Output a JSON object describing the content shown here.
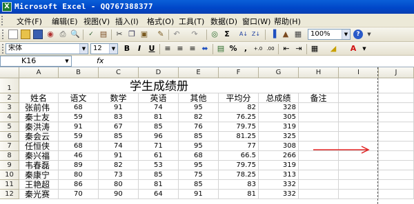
{
  "app": {
    "title": "Microsoft Excel - QQ767388377",
    "icon_label": "X"
  },
  "menu": [
    {
      "label": "文件(F)"
    },
    {
      "label": "编辑(E)"
    },
    {
      "label": "视图(V)"
    },
    {
      "label": "插入(I)"
    },
    {
      "label": "格式(O)"
    },
    {
      "label": "工具(T)"
    },
    {
      "label": "数据(D)"
    },
    {
      "label": "窗口(W)"
    },
    {
      "label": "帮助(H)"
    }
  ],
  "toolbar_standard": {
    "icons": [
      "new-icon",
      "open-icon",
      "save-icon",
      "permission-icon",
      "print-icon",
      "print-preview-icon",
      "spelling-icon",
      "research-icon",
      "cut-icon",
      "copy-icon",
      "paste-icon",
      "format-painter-icon",
      "undo-icon",
      "redo-icon",
      "hyperlink-icon",
      "autosum-icon",
      "sort-ascending-icon",
      "sort-descending-icon",
      "chart-wizard-icon",
      "drawing-icon",
      "help-icon"
    ],
    "zoom": "100%"
  },
  "toolbar_format": {
    "font_name": "宋体",
    "font_size": "12",
    "bold": "B",
    "italic": "I",
    "underline": "U",
    "percent": "%",
    "comma": ","
  },
  "formula_bar": {
    "name_box": "K16",
    "fx": "fx",
    "content": ""
  },
  "columns": [
    "A",
    "B",
    "C",
    "D",
    "E",
    "F",
    "G",
    "H",
    "I",
    "J"
  ],
  "rows": [
    "1",
    "2",
    "3",
    "4",
    "5",
    "6",
    "7",
    "8",
    "9",
    "10",
    "11",
    "12"
  ],
  "sheet": {
    "title": "学生成绩册",
    "headers": [
      "姓名",
      "语文",
      "数学",
      "英语",
      "其他",
      "平均分",
      "总成绩",
      "备注"
    ],
    "data": [
      [
        "张前伟",
        "68",
        "91",
        "74",
        "95",
        "82",
        "328"
      ],
      [
        "秦士友",
        "59",
        "83",
        "81",
        "82",
        "76.25",
        "305"
      ],
      [
        "秦洪涛",
        "91",
        "67",
        "85",
        "76",
        "79.75",
        "319"
      ],
      [
        "秦会云",
        "59",
        "85",
        "96",
        "85",
        "81.25",
        "325"
      ],
      [
        "任恒侠",
        "68",
        "74",
        "71",
        "95",
        "77",
        "308"
      ],
      [
        "秦兴福",
        "46",
        "91",
        "61",
        "68",
        "66.5",
        "266"
      ],
      [
        "韦春磊",
        "89",
        "82",
        "53",
        "95",
        "79.75",
        "319"
      ],
      [
        "秦康宁",
        "80",
        "73",
        "85",
        "75",
        "78.25",
        "313"
      ],
      [
        "王艳超",
        "86",
        "80",
        "81",
        "85",
        "83",
        "332"
      ],
      [
        "秦光赛",
        "70",
        "90",
        "64",
        "91",
        "81",
        "332"
      ]
    ]
  },
  "annotation": {
    "color": "#e02020"
  }
}
